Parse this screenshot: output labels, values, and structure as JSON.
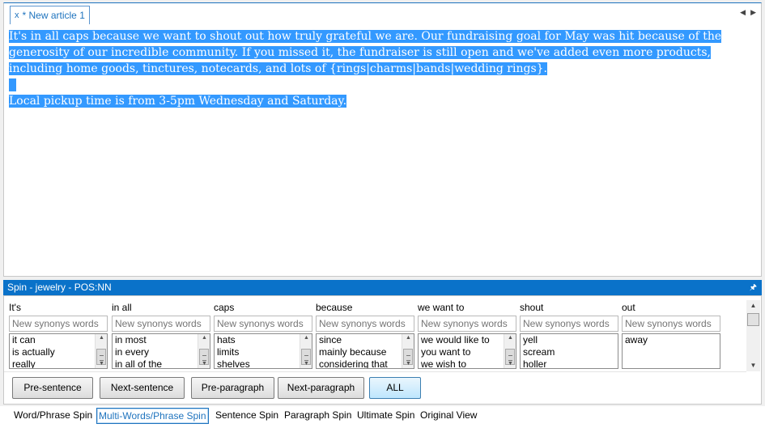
{
  "document": {
    "tab_title": "* New article 1",
    "tab_close": "x",
    "paragraphs": [
      "It's in all caps because we want to shout out how truly grateful we are. Our fundraising goal for May was hit because of the generosity of our incredible community. If you missed it, the fundraiser is still open and we've added even more products, including home goods, tinctures, notecards, and lots of {rings|charms|bands|wedding rings}.",
      "Local pickup time is from 3-5pm Wednesday and Saturday."
    ],
    "selection_color": "#3399ff"
  },
  "spin_panel": {
    "title": "Spin - jewelry - POS:NN",
    "placeholder": "New synonys words",
    "columns": [
      {
        "label": "It's",
        "items": [
          "it can",
          "is actually",
          "really"
        ]
      },
      {
        "label": "in all",
        "items": [
          "in most",
          "in every",
          "in all of the"
        ]
      },
      {
        "label": "caps",
        "items": [
          "hats",
          "limits",
          "shelves"
        ]
      },
      {
        "label": "because",
        "items": [
          "since",
          "mainly because",
          "considering that"
        ]
      },
      {
        "label": "we want to",
        "items": [
          "we would like to",
          "you want to",
          "we wish to"
        ]
      },
      {
        "label": "shout",
        "items": [
          "yell",
          "scream",
          "holler"
        ]
      },
      {
        "label": "out",
        "items": [
          "away"
        ]
      }
    ],
    "buttons": {
      "pre_sentence": "Pre-sentence",
      "next_sentence": "Next-sentence",
      "pre_paragraph": "Pre-paragraph",
      "next_paragraph": "Next-paragraph",
      "all": "ALL"
    }
  },
  "bottom_tabs": {
    "word_phrase": "Word/Phrase Spin",
    "multi_words": "Multi-Words/Phrase Spin",
    "sentence": "Sentence Spin",
    "paragraph": "Paragraph Spin",
    "ultimate": "Ultimate Spin",
    "original": "Original View"
  },
  "colors": {
    "accent": "#1e73be",
    "panel_header": "#0a72c9"
  }
}
